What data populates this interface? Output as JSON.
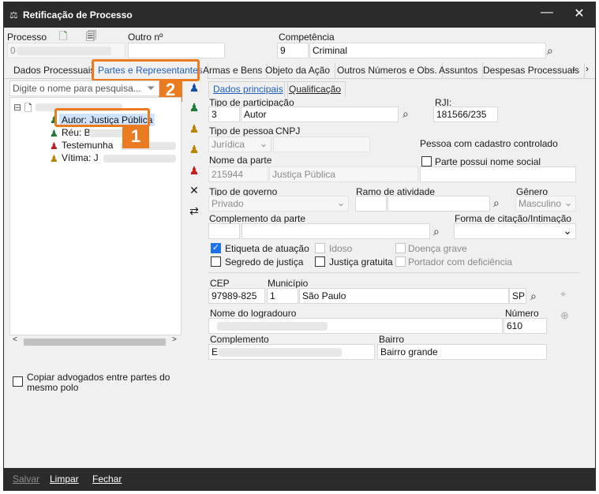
{
  "window": {
    "title": "Retificação de Processo",
    "minimize": "—",
    "close": "✕"
  },
  "header": {
    "processo_label": "Processo",
    "processo_value": "0",
    "outro_label": "Outro nº",
    "competencia_label": "Competência",
    "competencia_code": "9",
    "competencia_name": "Criminal"
  },
  "tabs": [
    "Dados Processuais",
    "Partes e Representantes",
    "Armas e Bens",
    "Objeto da Ação",
    "Outros Números e Obs.",
    "Assuntos",
    "Despesas Processuais"
  ],
  "tab_nav": {
    "prev": "‹",
    "next": "›"
  },
  "search": {
    "placeholder": "Digite o nome para pesquisa..."
  },
  "tree": {
    "items": [
      {
        "label": "Autor: Justiça Pública"
      },
      {
        "label": "Réu: B"
      },
      {
        "label": "Testemunha"
      },
      {
        "label": "Vítima: J"
      }
    ]
  },
  "copy_lawyers": {
    "label": "Copiar advogados entre partes do mesmo polo"
  },
  "callouts": {
    "one": "1",
    "two": "2"
  },
  "subtabs": {
    "dados": "Dados principais",
    "qualificacao": "Qualificação"
  },
  "form": {
    "tipo_participacao_label": "Tipo de participação",
    "tipo_participacao_code": "3",
    "tipo_participacao_name": "Autor",
    "rji_label": "RJI:",
    "rji_value": "181566/235",
    "tipo_pessoa_label": "Tipo de pessoa",
    "tipo_pessoa_value": "Jurídica",
    "cnpj_label": "CNPJ",
    "cadastro_controlado_label": "Pessoa com cadastro controlado",
    "nome_parte_label": "Nome da parte",
    "nome_parte_code": "215944",
    "nome_parte_value": "Justiça Pública",
    "nome_social_label": "Parte possui nome social",
    "tipo_governo_label": "Tipo de governo",
    "tipo_governo_value": "Privado",
    "ramo_atividade_label": "Ramo de atividade",
    "genero_label": "Gênero",
    "genero_value": "Masculino",
    "complemento_parte_label": "Complemento da parte",
    "forma_citacao_label": "Forma de citação/Intimação",
    "etiqueta_label": "Etiqueta de atuação",
    "idoso_label": "Idoso",
    "doenca_label": "Doença grave",
    "segredo_label": "Segredo de justiça",
    "gratuita_label": "Justiça gratuita",
    "portador_label": "Portador com deficiência",
    "cep_label": "CEP",
    "cep_value": "97989-825",
    "municipio_label": "Município",
    "municipio_code": "1",
    "municipio_name": "São Paulo",
    "uf_value": "SP",
    "logradouro_label": "Nome do logradouro",
    "numero_label": "Número",
    "numero_value": "610",
    "complemento_label": "Complemento",
    "complemento_value": "E",
    "bairro_label": "Bairro",
    "bairro_value": "Bairro grande"
  },
  "footer": {
    "salvar": "Salvar",
    "limpar": "Limpar",
    "fechar": "Fechar"
  },
  "colors": {
    "accent_orange": "#ea7b21",
    "titlebar": "#2b2b2b",
    "link_blue": "#1f5fbf"
  }
}
